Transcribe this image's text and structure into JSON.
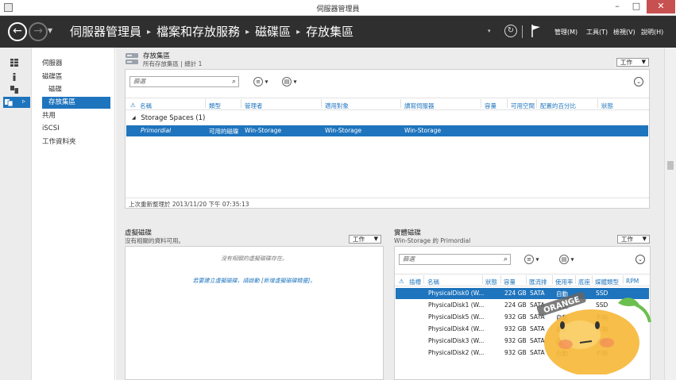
{
  "window": {
    "title": "伺服器管理員",
    "minimize": "–",
    "maximize": "□",
    "close": "✕"
  },
  "header": {
    "breadcrumb": [
      "伺服器管理員",
      "檔案和存放服務",
      "磁碟區",
      "存放集區"
    ],
    "menus": [
      "管理(M)",
      "工具(T)",
      "檢視(V)",
      "說明(H)"
    ]
  },
  "nav": {
    "items": [
      {
        "label": "伺服器",
        "sub": false,
        "selected": false
      },
      {
        "label": "磁碟區",
        "sub": false,
        "selected": false
      },
      {
        "label": "磁碟",
        "sub": true,
        "selected": false
      },
      {
        "label": "存放集區",
        "sub": true,
        "selected": true
      },
      {
        "label": "共用",
        "sub": false,
        "selected": false
      },
      {
        "label": "iSCSI",
        "sub": false,
        "selected": false
      },
      {
        "label": "工作資料夾",
        "sub": false,
        "selected": false
      }
    ]
  },
  "pools": {
    "title": "存放集區",
    "subtitle": "所有存放集區 | 總計 1",
    "tasks_label": "工作",
    "filter_placeholder": "篩選",
    "columns": [
      "名稱",
      "類型",
      "管理者",
      "適用對象",
      "讀寫伺服器",
      "容量",
      "可用空間",
      "配置的百分比",
      "狀態"
    ],
    "group_label": "Storage Spaces (1)",
    "rows": [
      {
        "name": "Primordial",
        "type": "可用的磁碟",
        "managed_by": "Win-Storage",
        "available_to": "Win-Storage",
        "rw_server": "Win-Storage",
        "capacity": "",
        "free": "",
        "allocated": "",
        "status": ""
      }
    ],
    "status_text": "上次重新整理於 2013/11/20 下午 07:35:13"
  },
  "virtual_disks": {
    "title": "虛擬磁碟",
    "subtitle": "沒有相關的資料可用。",
    "tasks_label": "工作",
    "empty_message": "沒有相關的虛擬磁碟存在。",
    "create_link": "若要建立虛擬磁碟，請啟動 [新增虛擬磁碟精靈]。"
  },
  "physical_disks": {
    "title": "實體磁碟",
    "subtitle": "Win-Storage 的 Primordial",
    "tasks_label": "工作",
    "filter_placeholder": "篩選",
    "columns": [
      "插槽",
      "名稱",
      "狀態",
      "容量",
      "匯流排",
      "使用率",
      "底座",
      "媒體類型",
      "RPM"
    ],
    "rows": [
      {
        "slot": "",
        "name": "PhysicalDisk0 (W...",
        "status": "",
        "capacity": "224 GB",
        "bus": "SATA",
        "usage": "自動",
        "chassis": "",
        "media": "SSD",
        "rpm": "",
        "selected": true
      },
      {
        "slot": "",
        "name": "PhysicalDisk1 (W...",
        "status": "",
        "capacity": "224 GB",
        "bus": "SATA",
        "usage": "自動",
        "chassis": "",
        "media": "SSD",
        "rpm": "",
        "selected": false
      },
      {
        "slot": "",
        "name": "PhysicalDisk5 (W...",
        "status": "",
        "capacity": "932 GB",
        "bus": "SATA",
        "usage": "自動",
        "chassis": "",
        "media": "不明",
        "rpm": "",
        "selected": false
      },
      {
        "slot": "",
        "name": "PhysicalDisk4 (W...",
        "status": "",
        "capacity": "932 GB",
        "bus": "SATA",
        "usage": "自動",
        "chassis": "",
        "media": "不明",
        "rpm": "",
        "selected": false
      },
      {
        "slot": "",
        "name": "PhysicalDisk3 (W...",
        "status": "",
        "capacity": "932 GB",
        "bus": "SATA",
        "usage": "自動",
        "chassis": "",
        "media": "不明",
        "rpm": "",
        "selected": false
      },
      {
        "slot": "",
        "name": "PhysicalDisk2 (W...",
        "status": "",
        "capacity": "932 GB",
        "bus": "SATA",
        "usage": "自動",
        "chassis": "",
        "media": "不明",
        "rpm": "",
        "selected": false
      }
    ]
  },
  "watermark": {
    "text": "ORANGE"
  },
  "colors": {
    "accent": "#1e74bd",
    "header_bg": "#2f2f2f",
    "mascot": "#f6b93b"
  }
}
